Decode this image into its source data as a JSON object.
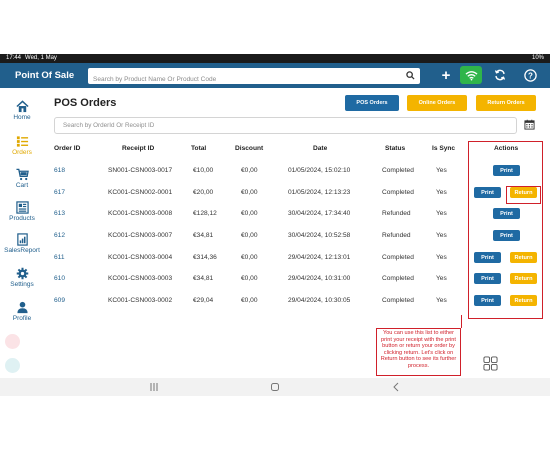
{
  "status_bar": {
    "time": "17:44",
    "date": "Wed, 1 May",
    "battery": "10%"
  },
  "app": {
    "title": "Point Of Sale",
    "search_placeholder": "Search by Product Name Or Product Code"
  },
  "sidebar": {
    "items": [
      {
        "label": "Home",
        "icon": "home-icon"
      },
      {
        "label": "Orders",
        "icon": "orders-icon"
      },
      {
        "label": "Cart",
        "icon": "cart-icon"
      },
      {
        "label": "Products",
        "icon": "products-icon"
      },
      {
        "label": "SalesReport",
        "icon": "sales-report-icon"
      },
      {
        "label": "Settings",
        "icon": "settings-icon"
      },
      {
        "label": "Profile",
        "icon": "profile-icon"
      }
    ]
  },
  "page": {
    "title": "POS Orders",
    "buttons": {
      "pos_orders": "POS Orders",
      "online_orders": "Online Orders",
      "return_orders": "Return Orders"
    },
    "order_search_placeholder": "Search by OrderId Or Receipt ID"
  },
  "table": {
    "headers": [
      "Order ID",
      "Receipt ID",
      "Total",
      "Discount",
      "Date",
      "Status",
      "Is Sync",
      "Actions"
    ],
    "rows": [
      {
        "order_id": "618",
        "receipt_id": "SN001-CSN003-0017",
        "total": "€10,00",
        "discount": "€0,00",
        "date": "01/05/2024, 15:02:10",
        "status": "Completed",
        "is_sync": "Yes",
        "actions": [
          "Print"
        ]
      },
      {
        "order_id": "617",
        "receipt_id": "KC001-CSN002-0001",
        "total": "€20,00",
        "discount": "€0,00",
        "date": "01/05/2024, 12:13:23",
        "status": "Completed",
        "is_sync": "Yes",
        "actions": [
          "Print",
          "Return"
        ]
      },
      {
        "order_id": "613",
        "receipt_id": "KC001-CSN003-0008",
        "total": "€128,12",
        "discount": "€0,00",
        "date": "30/04/2024, 17:34:40",
        "status": "Refunded",
        "is_sync": "Yes",
        "actions": [
          "Print"
        ]
      },
      {
        "order_id": "612",
        "receipt_id": "KC001-CSN003-0007",
        "total": "€34,81",
        "discount": "€0,00",
        "date": "30/04/2024, 10:52:58",
        "status": "Refunded",
        "is_sync": "Yes",
        "actions": [
          "Print"
        ]
      },
      {
        "order_id": "611",
        "receipt_id": "KC001-CSN003-0004",
        "total": "€314,36",
        "discount": "€0,00",
        "date": "29/04/2024, 12:13:01",
        "status": "Completed",
        "is_sync": "Yes",
        "actions": [
          "Print",
          "Return"
        ]
      },
      {
        "order_id": "610",
        "receipt_id": "KC001-CSN003-0003",
        "total": "€34,81",
        "discount": "€0,00",
        "date": "29/04/2024, 10:31:00",
        "status": "Completed",
        "is_sync": "Yes",
        "actions": [
          "Print",
          "Return"
        ]
      },
      {
        "order_id": "609",
        "receipt_id": "KC001-CSN003-0002",
        "total": "€29,04",
        "discount": "€0,00",
        "date": "29/04/2024, 10:30:05",
        "status": "Completed",
        "is_sync": "Yes",
        "actions": [
          "Print",
          "Return"
        ]
      }
    ]
  },
  "callout": {
    "text": "You can use this list to either print your receipt with the print button or return your order by clicking return. Let's click on Return button to see its further process."
  },
  "colors": {
    "primary": "#215f8c",
    "button_blue": "#1f6aa3",
    "accent_yellow": "#f4b400",
    "sync_green": "#2fb54a",
    "annotation_red": "#d0202a"
  }
}
